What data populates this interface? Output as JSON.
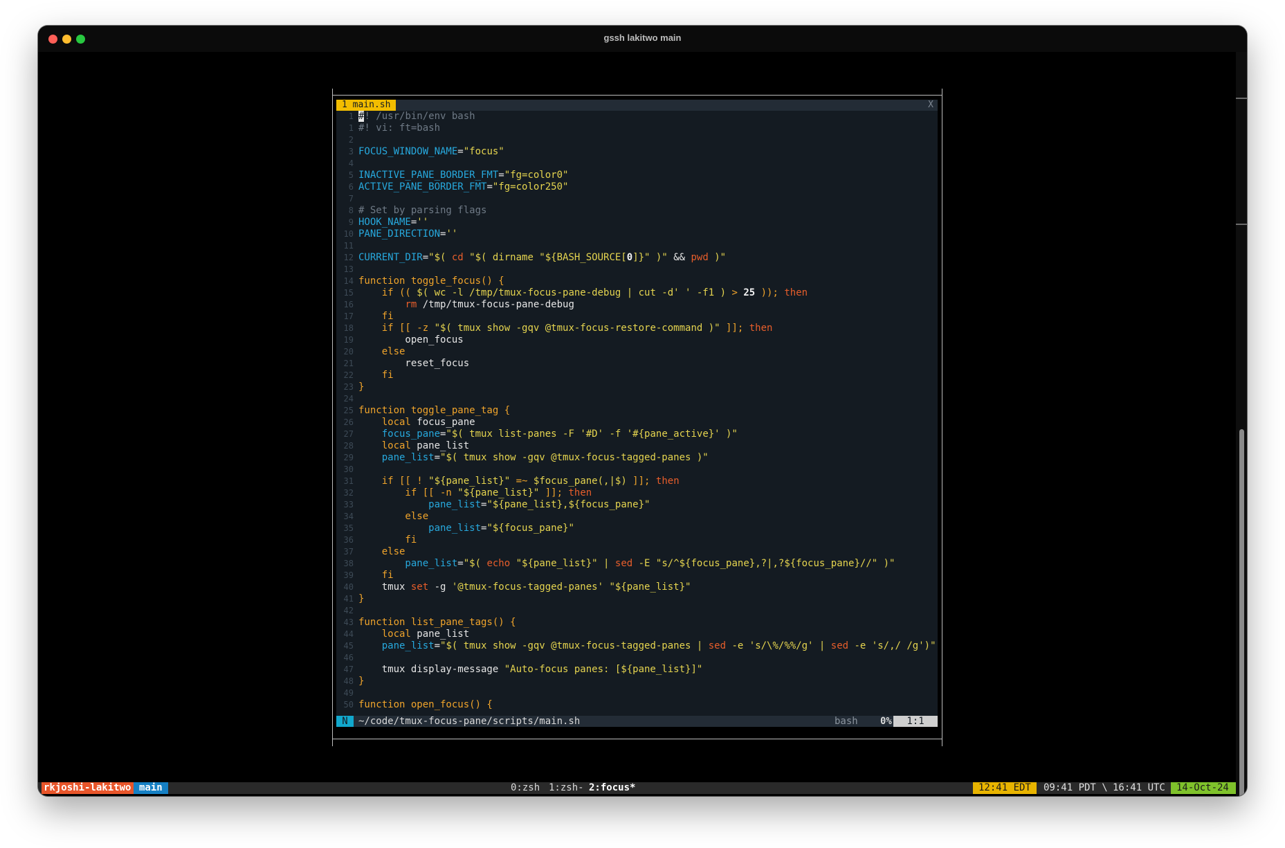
{
  "window": {
    "title": "gssh lakitwo main"
  },
  "editor": {
    "tab": {
      "label": "1 main.sh",
      "close_label": "X"
    },
    "lines": [
      {
        "num": "1",
        "segs": [
          {
            "t": "#",
            "cls": "cur"
          },
          {
            "t": "! /usr/bin/env bash",
            "cls": "c"
          }
        ]
      },
      {
        "num": "1",
        "segs": [
          {
            "t": "#! vi: ft=bash",
            "cls": "c"
          }
        ]
      },
      {
        "num": "2",
        "segs": []
      },
      {
        "num": "3",
        "segs": [
          {
            "t": "FOCUS_WINDOW_NAME",
            "cls": "v"
          },
          {
            "t": "=",
            "cls": "w"
          },
          {
            "t": "\"focus\"",
            "cls": "s"
          }
        ]
      },
      {
        "num": "4",
        "segs": []
      },
      {
        "num": "5",
        "segs": [
          {
            "t": "INACTIVE_PANE_BORDER_FMT",
            "cls": "v"
          },
          {
            "t": "=",
            "cls": "w"
          },
          {
            "t": "\"fg=color0\"",
            "cls": "s"
          }
        ]
      },
      {
        "num": "6",
        "segs": [
          {
            "t": "ACTIVE_PANE_BORDER_FMT",
            "cls": "v"
          },
          {
            "t": "=",
            "cls": "w"
          },
          {
            "t": "\"fg=color250\"",
            "cls": "s"
          }
        ]
      },
      {
        "num": "7",
        "segs": []
      },
      {
        "num": "8",
        "segs": [
          {
            "t": "# Set by parsing flags",
            "cls": "c"
          }
        ]
      },
      {
        "num": "9",
        "segs": [
          {
            "t": "HOOK_NAME",
            "cls": "v"
          },
          {
            "t": "=",
            "cls": "w"
          },
          {
            "t": "''",
            "cls": "s"
          }
        ]
      },
      {
        "num": "10",
        "segs": [
          {
            "t": "PANE_DIRECTION",
            "cls": "v"
          },
          {
            "t": "=",
            "cls": "w"
          },
          {
            "t": "''",
            "cls": "s"
          }
        ]
      },
      {
        "num": "11",
        "segs": []
      },
      {
        "num": "12",
        "segs": [
          {
            "t": "CURRENT_DIR",
            "cls": "v"
          },
          {
            "t": "=",
            "cls": "w"
          },
          {
            "t": "\"$( ",
            "cls": "s"
          },
          {
            "t": "cd",
            "cls": "o"
          },
          {
            "t": " \"$( dirname \"${BASH_SOURCE[",
            "cls": "s"
          },
          {
            "t": "0",
            "cls": "n"
          },
          {
            "t": "]}\" )\" ",
            "cls": "s"
          },
          {
            "t": "&&",
            "cls": "w"
          },
          {
            "t": " ",
            "cls": "s"
          },
          {
            "t": "pwd",
            "cls": "o"
          },
          {
            "t": " )\"",
            "cls": "s"
          }
        ]
      },
      {
        "num": "13",
        "segs": []
      },
      {
        "num": "14",
        "segs": [
          {
            "t": "function toggle_focus() {",
            "cls": "k"
          }
        ]
      },
      {
        "num": "15",
        "segs": [
          {
            "t": "    if (( ",
            "cls": "k"
          },
          {
            "t": "$( wc -l /tmp/tmux-focus-pane-debug | cut -d' ' -f1 )",
            "cls": "s"
          },
          {
            "t": " > ",
            "cls": "k"
          },
          {
            "t": "25",
            "cls": "n"
          },
          {
            "t": " )); ",
            "cls": "k"
          },
          {
            "t": "then",
            "cls": "o"
          }
        ]
      },
      {
        "num": "16",
        "segs": [
          {
            "t": "        ",
            "cls": "w"
          },
          {
            "t": "rm",
            "cls": "o"
          },
          {
            "t": " /tmp/tmux-focus-pane-debug",
            "cls": "w"
          }
        ]
      },
      {
        "num": "17",
        "segs": [
          {
            "t": "    fi",
            "cls": "k"
          }
        ]
      },
      {
        "num": "18",
        "segs": [
          {
            "t": "    if [[ -z ",
            "cls": "k"
          },
          {
            "t": "\"$( tmux show -gqv @tmux-focus-restore-command )\"",
            "cls": "s"
          },
          {
            "t": " ]]; ",
            "cls": "k"
          },
          {
            "t": "then",
            "cls": "o"
          }
        ]
      },
      {
        "num": "19",
        "segs": [
          {
            "t": "        open_focus",
            "cls": "w"
          }
        ]
      },
      {
        "num": "20",
        "segs": [
          {
            "t": "    else",
            "cls": "k"
          }
        ]
      },
      {
        "num": "21",
        "segs": [
          {
            "t": "        reset_focus",
            "cls": "w"
          }
        ]
      },
      {
        "num": "22",
        "segs": [
          {
            "t": "    fi",
            "cls": "k"
          }
        ]
      },
      {
        "num": "23",
        "segs": [
          {
            "t": "}",
            "cls": "k"
          }
        ]
      },
      {
        "num": "24",
        "segs": []
      },
      {
        "num": "25",
        "segs": [
          {
            "t": "function toggle_pane_tag {",
            "cls": "k"
          }
        ]
      },
      {
        "num": "26",
        "segs": [
          {
            "t": "    local",
            "cls": "k"
          },
          {
            "t": " focus_pane",
            "cls": "w"
          }
        ]
      },
      {
        "num": "27",
        "segs": [
          {
            "t": "    focus_pane",
            "cls": "v"
          },
          {
            "t": "=",
            "cls": "w"
          },
          {
            "t": "\"$( tmux list-panes -F '#D' -f '#{pane_active}' )\"",
            "cls": "s"
          }
        ]
      },
      {
        "num": "28",
        "segs": [
          {
            "t": "    local",
            "cls": "k"
          },
          {
            "t": " pane_list",
            "cls": "w"
          }
        ]
      },
      {
        "num": "29",
        "segs": [
          {
            "t": "    pane_list",
            "cls": "v"
          },
          {
            "t": "=",
            "cls": "w"
          },
          {
            "t": "\"$( tmux show -gqv @tmux-focus-tagged-panes )\"",
            "cls": "s"
          }
        ]
      },
      {
        "num": "30",
        "segs": []
      },
      {
        "num": "31",
        "segs": [
          {
            "t": "    if [[ ! ",
            "cls": "k"
          },
          {
            "t": "\"${pane_list}\"",
            "cls": "s"
          },
          {
            "t": " =~ ",
            "cls": "k"
          },
          {
            "t": "$focus_pane(,|$)",
            "cls": "s"
          },
          {
            "t": " ]]; ",
            "cls": "k"
          },
          {
            "t": "then",
            "cls": "o"
          }
        ]
      },
      {
        "num": "32",
        "segs": [
          {
            "t": "        if [[ -n ",
            "cls": "k"
          },
          {
            "t": "\"${pane_list}\"",
            "cls": "s"
          },
          {
            "t": " ]]; ",
            "cls": "k"
          },
          {
            "t": "then",
            "cls": "o"
          }
        ]
      },
      {
        "num": "33",
        "segs": [
          {
            "t": "            pane_list",
            "cls": "v"
          },
          {
            "t": "=",
            "cls": "w"
          },
          {
            "t": "\"${pane_list},${focus_pane}\"",
            "cls": "s"
          }
        ]
      },
      {
        "num": "34",
        "segs": [
          {
            "t": "        else",
            "cls": "k"
          }
        ]
      },
      {
        "num": "35",
        "segs": [
          {
            "t": "            pane_list",
            "cls": "v"
          },
          {
            "t": "=",
            "cls": "w"
          },
          {
            "t": "\"${focus_pane}\"",
            "cls": "s"
          }
        ]
      },
      {
        "num": "36",
        "segs": [
          {
            "t": "        fi",
            "cls": "k"
          }
        ]
      },
      {
        "num": "37",
        "segs": [
          {
            "t": "    else",
            "cls": "k"
          }
        ]
      },
      {
        "num": "38",
        "segs": [
          {
            "t": "        pane_list",
            "cls": "v"
          },
          {
            "t": "=",
            "cls": "w"
          },
          {
            "t": "\"$( ",
            "cls": "s"
          },
          {
            "t": "echo",
            "cls": "o"
          },
          {
            "t": " \"${pane_list}\" | ",
            "cls": "s"
          },
          {
            "t": "sed",
            "cls": "o"
          },
          {
            "t": " -E \"s/^${focus_pane},?|,?${focus_pane}//\" )\"",
            "cls": "s"
          }
        ]
      },
      {
        "num": "39",
        "segs": [
          {
            "t": "    fi",
            "cls": "k"
          }
        ]
      },
      {
        "num": "40",
        "segs": [
          {
            "t": "    tmux ",
            "cls": "w"
          },
          {
            "t": "set",
            "cls": "o"
          },
          {
            "t": " -g ",
            "cls": "w"
          },
          {
            "t": "'@tmux-focus-tagged-panes' \"${pane_list}\"",
            "cls": "s"
          }
        ]
      },
      {
        "num": "41",
        "segs": [
          {
            "t": "}",
            "cls": "k"
          }
        ]
      },
      {
        "num": "42",
        "segs": []
      },
      {
        "num": "43",
        "segs": [
          {
            "t": "function list_pane_tags() {",
            "cls": "k"
          }
        ]
      },
      {
        "num": "44",
        "segs": [
          {
            "t": "    local",
            "cls": "k"
          },
          {
            "t": " pane_list",
            "cls": "w"
          }
        ]
      },
      {
        "num": "45",
        "segs": [
          {
            "t": "    pane_list",
            "cls": "v"
          },
          {
            "t": "=",
            "cls": "w"
          },
          {
            "t": "\"$( tmux show -gqv @tmux-focus-tagged-panes | ",
            "cls": "s"
          },
          {
            "t": "sed",
            "cls": "o"
          },
          {
            "t": " -e 's/\\%/%%/g' | ",
            "cls": "s"
          },
          {
            "t": "sed",
            "cls": "o"
          },
          {
            "t": " -e 's/,/ /g')\"",
            "cls": "s"
          }
        ]
      },
      {
        "num": "46",
        "segs": []
      },
      {
        "num": "47",
        "segs": [
          {
            "t": "    tmux display-message ",
            "cls": "w"
          },
          {
            "t": "\"Auto-focus panes: [${pane_list}]\"",
            "cls": "s"
          }
        ]
      },
      {
        "num": "48",
        "segs": [
          {
            "t": "}",
            "cls": "k"
          }
        ]
      },
      {
        "num": "49",
        "segs": []
      },
      {
        "num": "50",
        "segs": [
          {
            "t": "function open_focus() {",
            "cls": "k"
          }
        ]
      }
    ],
    "status": {
      "mode": "N",
      "path": "~/code/tmux-focus-pane/scripts/main.sh",
      "filetype": "bash",
      "percent": "0%",
      "position": "1:1"
    }
  },
  "tmux": {
    "session": "rkjoshi-lakitwo",
    "branch": "main",
    "windows": [
      {
        "label": "0:zsh",
        "active": false
      },
      {
        "label": "1:zsh-",
        "active": false
      },
      {
        "label": "2:focus*",
        "active": true
      }
    ],
    "time_edt": "12:41 EDT",
    "time_pdt": "09:41 PDT \\",
    "time_utc": "16:41 UTC",
    "date": "14-Oct-24"
  },
  "colors": {
    "tab_active": "#f2bd00",
    "mode_normal": "#11a8cd",
    "session": "#e8552a",
    "branch": "#1680c4",
    "time_edt": "#e8b400",
    "date": "#7fc22b"
  }
}
